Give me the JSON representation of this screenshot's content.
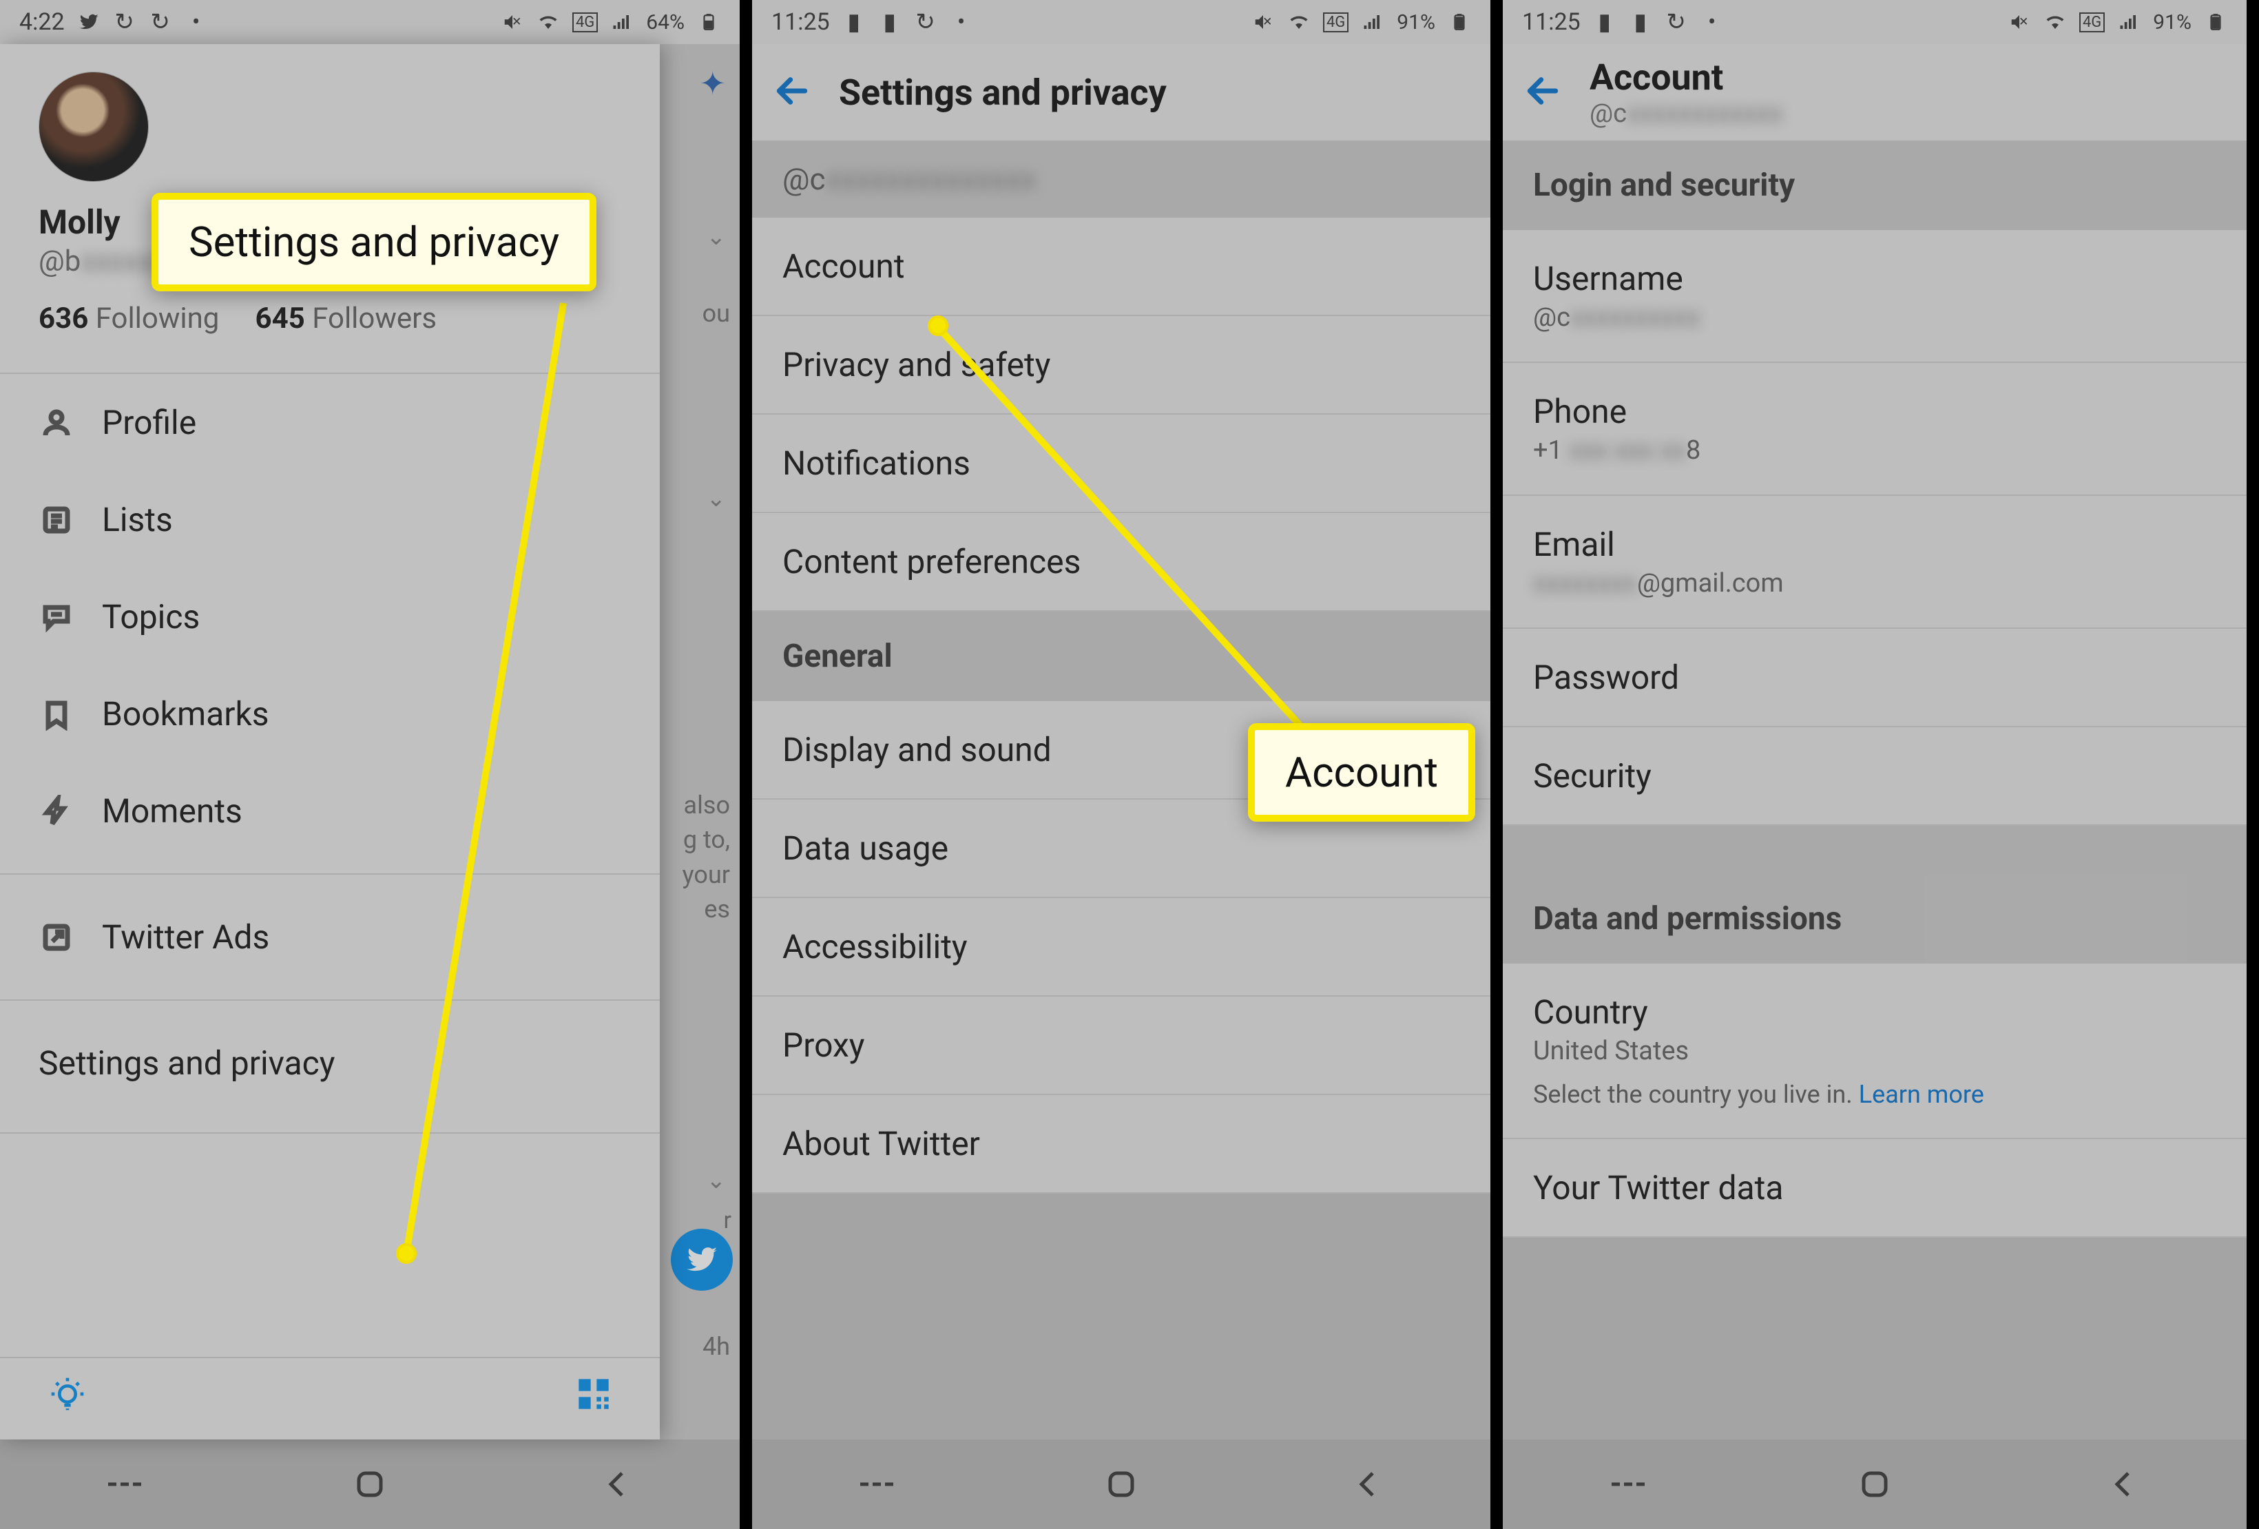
{
  "panel1": {
    "status": {
      "time": "4:22",
      "battery": "64%"
    },
    "feed_snippets": {
      "a": "ou",
      "b": "also",
      "c": "g to,",
      "d": "your",
      "e": "es",
      "f": "4h",
      "g": "r"
    },
    "profile": {
      "display_name": "Molly",
      "handle_prefix": "@b",
      "following_count": "636",
      "following_label": "Following",
      "followers_count": "645",
      "followers_label": "Followers"
    },
    "menu": {
      "profile": "Profile",
      "lists": "Lists",
      "topics": "Topics",
      "bookmarks": "Bookmarks",
      "moments": "Moments",
      "ads": "Twitter Ads",
      "settings": "Settings and privacy"
    },
    "callout": "Settings and privacy"
  },
  "panel2": {
    "status": {
      "time": "11:25",
      "battery": "91%"
    },
    "title": "Settings and privacy",
    "username_prefix": "@c",
    "items": {
      "account": "Account",
      "privacy": "Privacy and safety",
      "notifications": "Notifications",
      "content": "Content preferences"
    },
    "general_label": "General",
    "general": {
      "display": "Display and sound",
      "data": "Data usage",
      "accessibility": "Accessibility",
      "proxy": "Proxy",
      "about": "About Twitter"
    },
    "callout": "Account"
  },
  "panel3": {
    "status": {
      "time": "11:25",
      "battery": "91%"
    },
    "title": "Account",
    "sub_prefix": "@c",
    "sections": {
      "login": "Login and security",
      "data": "Data and permissions"
    },
    "rows": {
      "username_label": "Username",
      "username_value_prefix": "@c",
      "phone_label": "Phone",
      "phone_value_prefix": "+1 ",
      "phone_value_suffix": "8",
      "email_label": "Email",
      "email_value_suffix": "@gmail.com",
      "password": "Password",
      "security": "Security",
      "country_label": "Country",
      "country_value": "United States",
      "country_hint": "Select the country you live in. ",
      "learn_more": "Learn more",
      "twitter_data": "Your Twitter data"
    }
  }
}
